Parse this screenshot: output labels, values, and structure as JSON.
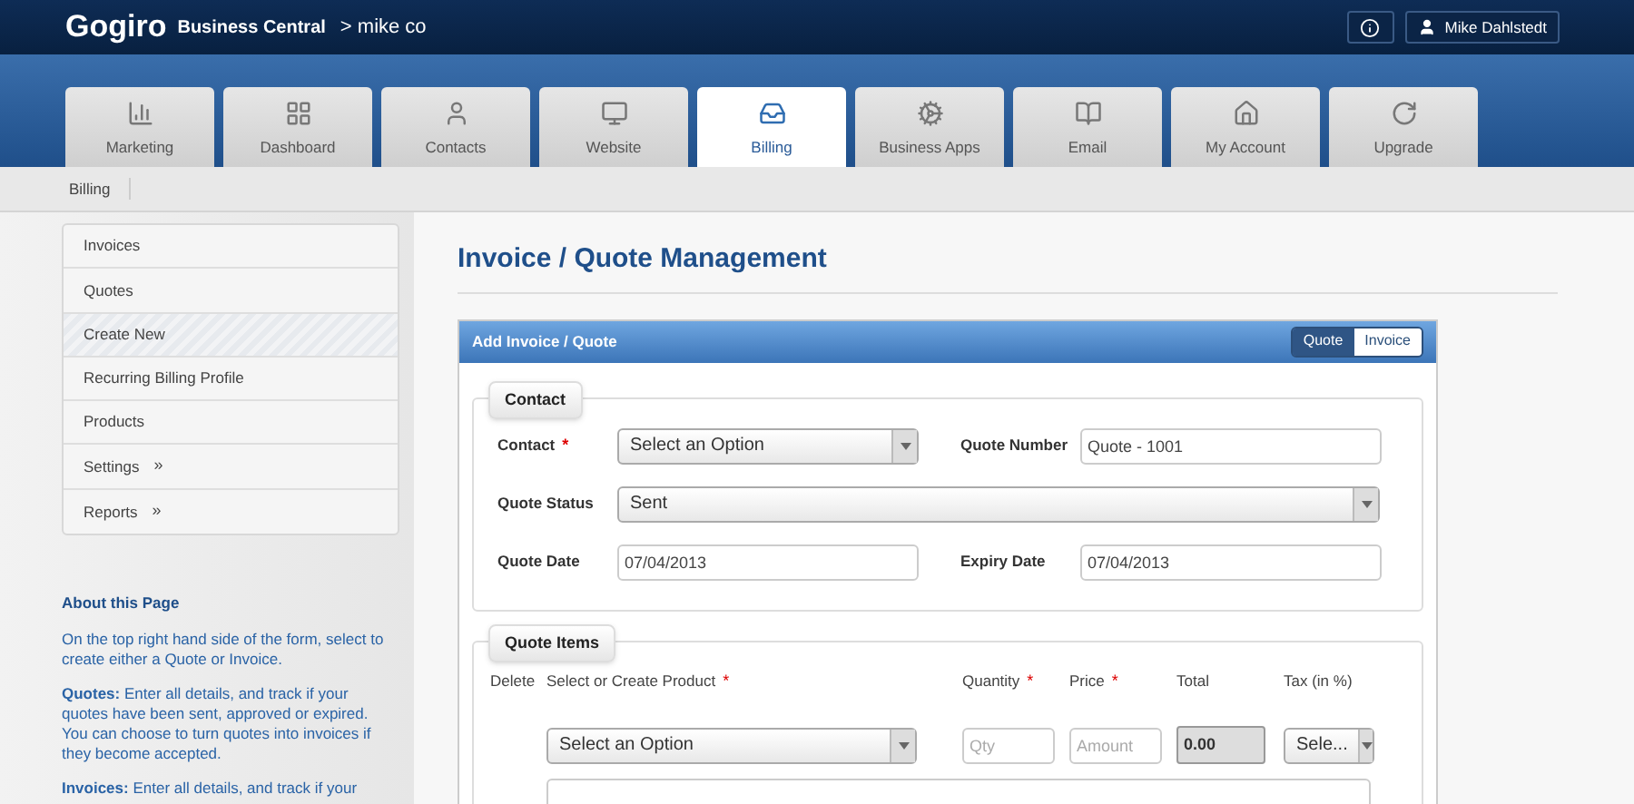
{
  "header": {
    "logo": "Gogiro",
    "product": "Business Central",
    "account": "> mike co",
    "user": "Mike Dahlstedt"
  },
  "tabs": [
    {
      "label": "Marketing",
      "selected": false
    },
    {
      "label": "Dashboard",
      "selected": false
    },
    {
      "label": "Contacts",
      "selected": false
    },
    {
      "label": "Website",
      "selected": false
    },
    {
      "label": "Billing",
      "selected": true
    },
    {
      "label": "Business Apps",
      "selected": false
    },
    {
      "label": "Email",
      "selected": false
    },
    {
      "label": "My Account",
      "selected": false
    },
    {
      "label": "Upgrade",
      "selected": false
    }
  ],
  "breadcrumb": [
    "Billing"
  ],
  "sidebar": {
    "items": [
      {
        "label": "Invoices",
        "selected": false
      },
      {
        "label": "Quotes",
        "selected": false
      },
      {
        "label": "Create New",
        "selected": true
      },
      {
        "label": "Recurring Billing Profile",
        "selected": false
      },
      {
        "label": "Products",
        "selected": false
      },
      {
        "label": "Settings",
        "arrow": "»",
        "selected": false
      },
      {
        "label": "Reports",
        "arrow": "»",
        "selected": false
      }
    ],
    "about": {
      "title": "About this Page",
      "paragraphs": [
        "On the top right hand side of the form, select to create either a Quote or Invoice.",
        "**Quotes:** Enter all details, and track if your quotes have been sent, approved or expired. You can choose to turn quotes into invoices if they become accepted.",
        "**Invoices:** Enter all details, and track if your"
      ]
    }
  },
  "page_title": "Invoice / Quote Management",
  "panel": {
    "title": "Add Invoice / Quote",
    "toggle": [
      {
        "label": "Quote",
        "selected": true
      },
      {
        "label": "Invoice",
        "selected": false
      }
    ],
    "contact": {
      "legend": "Contact",
      "fields": [
        {
          "label": "Contact",
          "required_mark": "*",
          "kind": "select",
          "value": "Select an Option"
        },
        {
          "label": "Quote Number",
          "kind": "input",
          "value": "Quote - 1001"
        },
        {
          "label": "Quote Status",
          "kind": "wide_select",
          "value": "Sent"
        },
        {
          "label": "Quote Date",
          "kind": "input",
          "value": "07/04/2013"
        },
        {
          "label": "Expiry Date",
          "kind": "input",
          "value": "07/04/2013"
        }
      ]
    },
    "items": {
      "legend": "Quote Items",
      "columns": [
        {
          "label": "Delete"
        },
        {
          "label": "Select or Create Product",
          "required_mark": "*"
        },
        {
          "label": "Quantity",
          "required_mark": "*"
        },
        {
          "label": "Price",
          "required_mark": "*"
        },
        {
          "label": "Total"
        },
        {
          "label": "Tax (in %)"
        }
      ],
      "row": {
        "product": "Select an Option",
        "quantity_placeholder": "Qty",
        "price_placeholder": "Amount",
        "total": "0.00",
        "tax": "Sele..."
      }
    }
  }
}
